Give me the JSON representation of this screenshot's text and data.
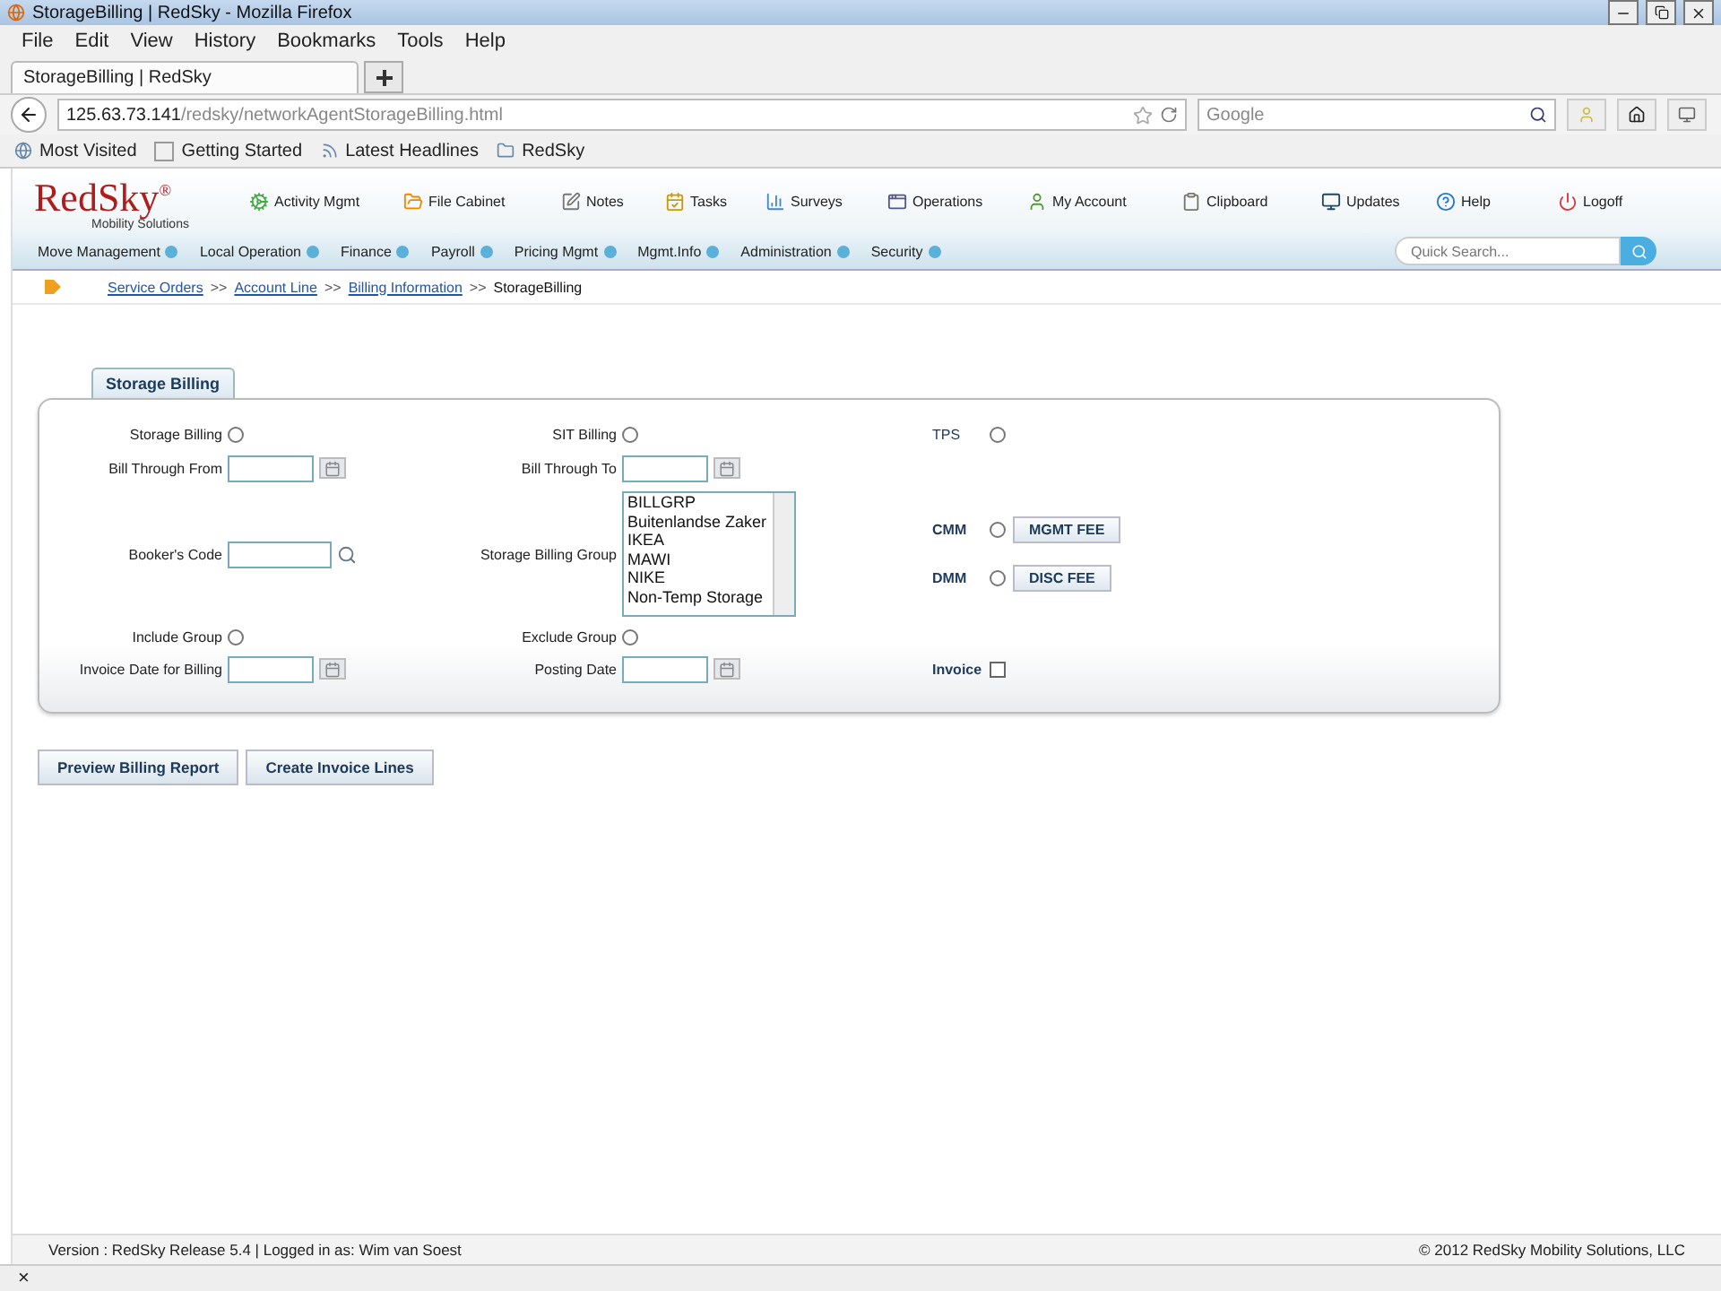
{
  "window": {
    "title": "StorageBilling | RedSky - Mozilla Firefox"
  },
  "menu_bar": [
    "File",
    "Edit",
    "View",
    "History",
    "Bookmarks",
    "Tools",
    "Help"
  ],
  "browser_tabs": [
    {
      "label": "StorageBilling | RedSky",
      "selected": true
    }
  ],
  "address_bar": {
    "host": "125.63.73.141",
    "path": "/redsky/networkAgentStorageBilling.html"
  },
  "search": {
    "placeholder": "Google"
  },
  "bookmarks": [
    "Most Visited",
    "Getting Started",
    "Latest Headlines",
    "RedSky"
  ],
  "app": {
    "logo": "RedSky",
    "logo_mark": "®",
    "tagline": "Mobility Solutions",
    "toolbar": [
      "Activity Mgmt",
      "File Cabinet",
      "Notes",
      "Tasks",
      "Surveys",
      "Operations",
      "My Account",
      "Clipboard",
      "Updates",
      "Help",
      "Logoff"
    ],
    "menu": [
      "Move Management",
      "Local Operation",
      "Finance",
      "Payroll",
      "Pricing Mgmt",
      "Mgmt.Info",
      "Administration",
      "Security"
    ],
    "quick_search": {
      "placeholder": "Quick Search..."
    },
    "breadcrumb": [
      {
        "label": "Service Orders",
        "link": true
      },
      {
        "label": "Account Line",
        "link": true
      },
      {
        "label": "Billing Information",
        "link": true
      },
      {
        "label": "StorageBilling",
        "link": false
      }
    ],
    "breadcrumb_separator": ">>"
  },
  "panel": {
    "tab": "Storage Billing",
    "rows": [
      {
        "left": {
          "kind": "radio",
          "label": "Storage Billing",
          "selected": false
        },
        "middle": {
          "kind": "radio",
          "label": "SIT Billing",
          "selected": false
        }
      },
      {
        "left": {
          "kind": "date",
          "label": "Bill Through From"
        },
        "middle": {
          "kind": "date",
          "label": "Bill Through To"
        }
      },
      {
        "left": {
          "kind": "lookup",
          "label": "Booker's Code"
        },
        "middle": {
          "kind": "listbox",
          "label": "Storage Billing Group",
          "options": [
            {
              "label": "BILLGRP",
              "selected": false
            },
            {
              "label": "Buitenlandse Zaker",
              "selected": false
            },
            {
              "label": "IKEA",
              "selected": false
            },
            {
              "label": "MAWI",
              "selected": false
            },
            {
              "label": "NIKE",
              "selected": false
            },
            {
              "label": "Non-Temp Storage",
              "selected": false
            }
          ]
        }
      },
      {
        "left": {
          "kind": "radio",
          "label": "Include Group",
          "selected": false
        },
        "middle": {
          "kind": "radio",
          "label": "Exclude Group",
          "selected": false
        }
      },
      {
        "left": {
          "kind": "date",
          "label": "Invoice Date for Billing"
        },
        "middle": {
          "kind": "date",
          "label": "Posting Date"
        }
      }
    ],
    "right": [
      {
        "kind": "radio",
        "label": "TPS",
        "selected": false
      },
      {
        "kind": "radio_button",
        "label": "CMM",
        "selected": false,
        "button": "MGMT FEE"
      },
      {
        "kind": "radio_button",
        "label": "DMM",
        "selected": false,
        "button": "DISC FEE"
      },
      {
        "kind": "checkbox",
        "label": "Invoice",
        "checked": false
      }
    ]
  },
  "actions": [
    "Preview Billing Report",
    "Create Invoice Lines"
  ],
  "footer": {
    "version": "Version : RedSky Release 5.4 | Logged in as: Wim van Soest",
    "copyright": "© 2012 RedSky Mobility Solutions, LLC"
  },
  "status_bar": {
    "close": "×"
  }
}
